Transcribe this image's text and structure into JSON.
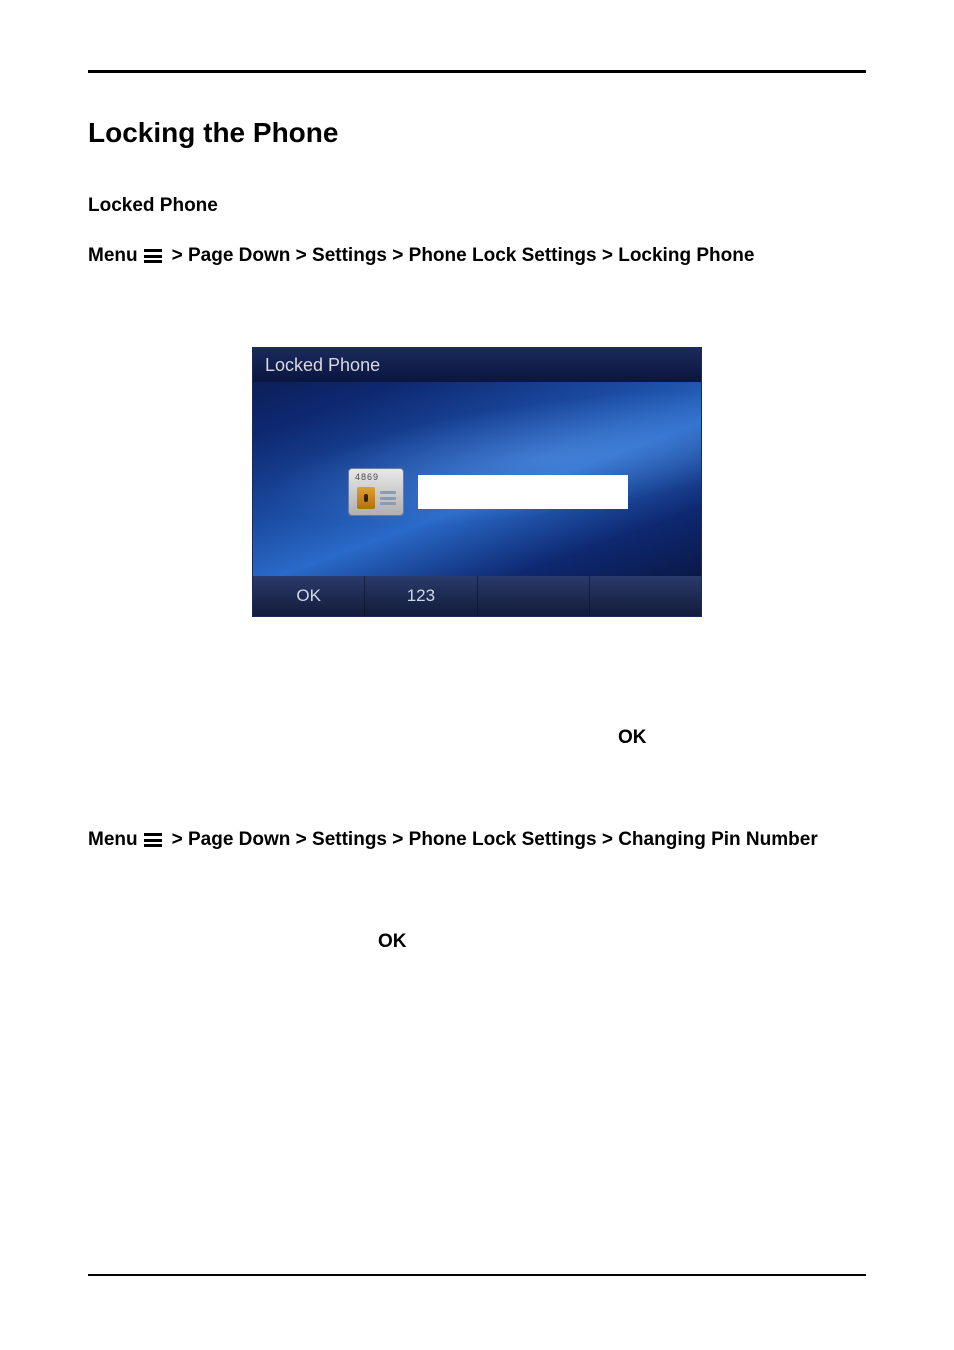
{
  "heading": "Locking the Phone",
  "subheading": "Locked Phone",
  "path1": {
    "menu": "Menu",
    "rest": "> Page Down > Settings > Phone Lock Settings > Locking Phone"
  },
  "screen": {
    "title": "Locked Phone",
    "lock_digits": "4869",
    "softkeys": [
      "OK",
      "123",
      "",
      ""
    ]
  },
  "ok1": "OK",
  "path2": {
    "menu": "Menu",
    "rest": "> Page Down > Settings > Phone Lock Settings > Changing Pin Number"
  },
  "ok2": "OK"
}
